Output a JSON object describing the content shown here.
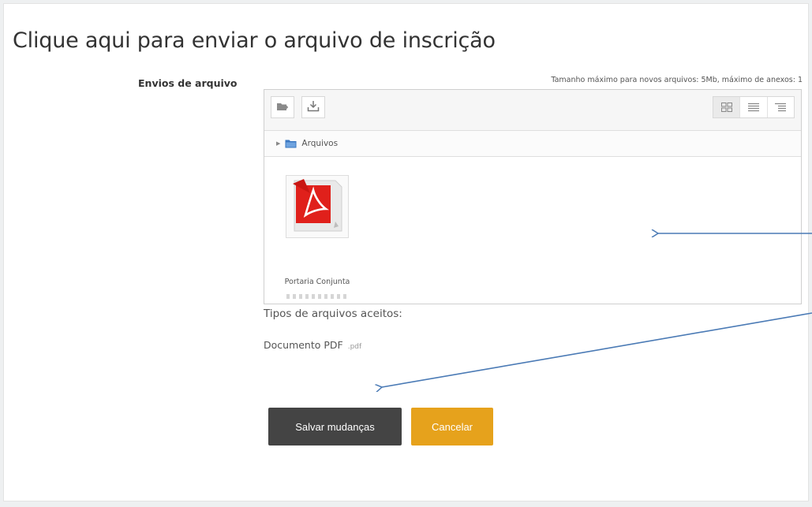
{
  "page": {
    "title": "Clique aqui para enviar o arquivo de inscrição"
  },
  "upload": {
    "field_label": "Envios de arquivo",
    "limits_text": "Tamanho máximo para novos arquivos: 5Mb, máximo de anexos: 1",
    "toolbar": {
      "add_icon": "add-file-icon",
      "download_icon": "download-icon",
      "views": [
        "grid-view-icon",
        "list-view-icon",
        "tree-view-icon"
      ]
    },
    "path": {
      "folder_icon": "folder-icon",
      "label": "Arquivos"
    },
    "files": [
      {
        "name": "Portaria Conjunta",
        "icon": "pdf-file-icon"
      }
    ]
  },
  "accepted": {
    "label": "Tipos de arquivos aceitos:",
    "type_name": "Documento PDF",
    "type_ext": ".pdf"
  },
  "actions": {
    "save_label": "Salvar mudanças",
    "cancel_label": "Cancelar"
  },
  "colors": {
    "save_button": "#444444",
    "cancel_button": "#e6a21c",
    "annotation_arrows": "#4a7ab5",
    "pdf_red": "#e0201b"
  }
}
